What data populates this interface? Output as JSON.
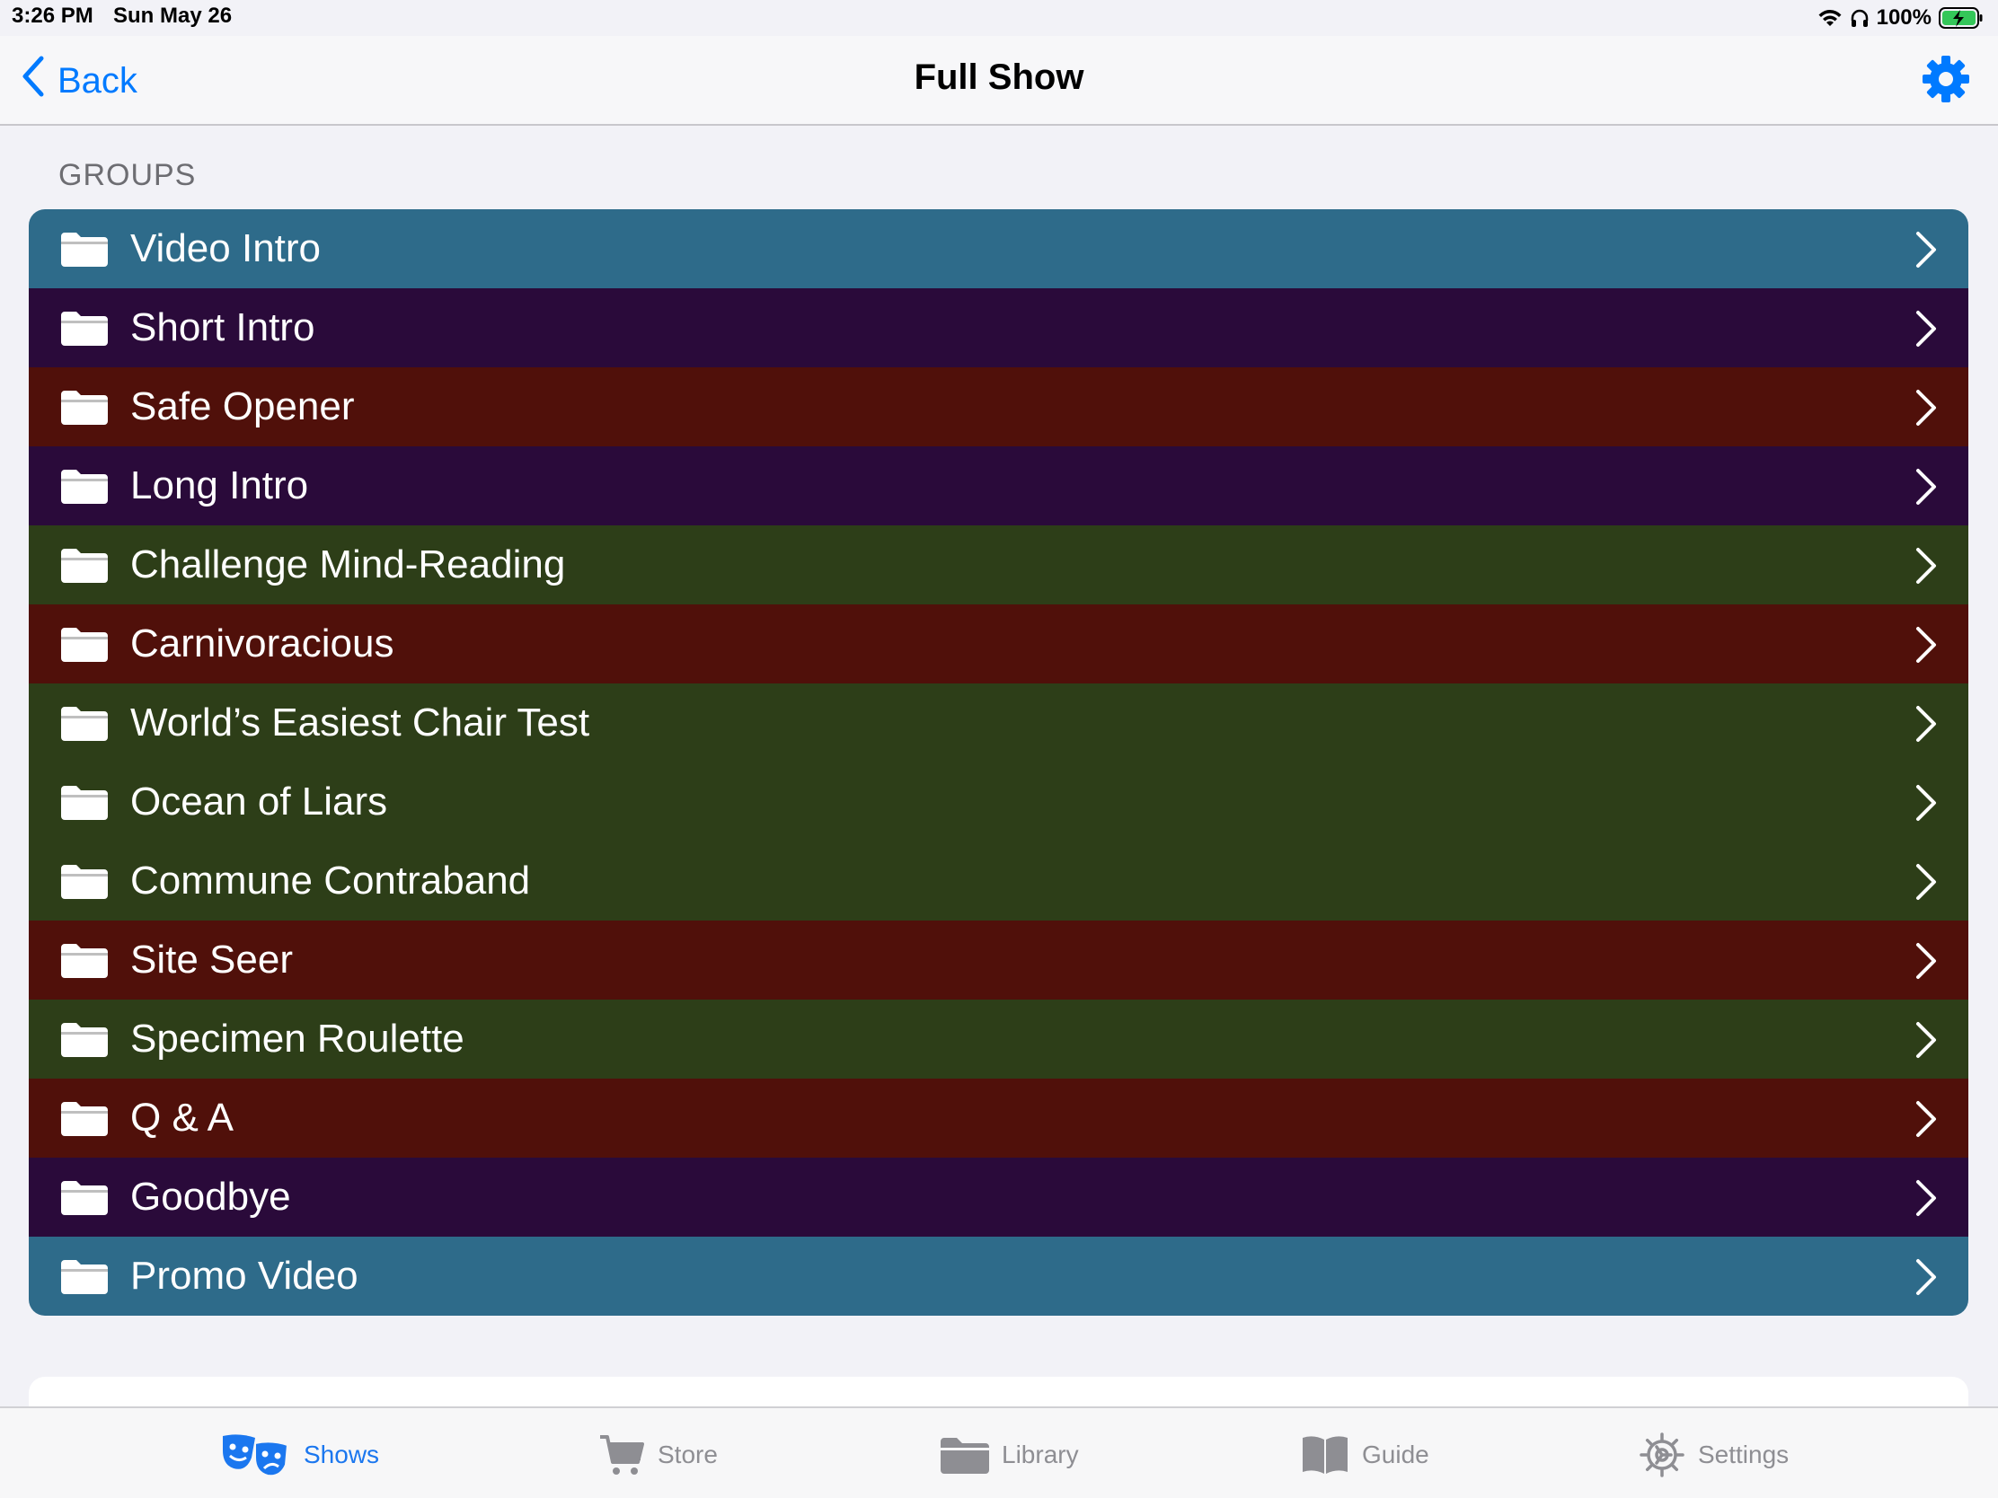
{
  "status_bar": {
    "time": "3:26 PM",
    "date": "Sun May 26",
    "battery_percent": "100%",
    "icons": [
      "wifi-icon",
      "headphones-icon",
      "battery-charging-icon"
    ]
  },
  "nav": {
    "back_label": "Back",
    "title": "Full Show",
    "right_icon": "gear-icon",
    "accent_color": "#007aff"
  },
  "groups": {
    "header": "GROUPS",
    "items": [
      {
        "label": "Video Intro",
        "color": "#2e6b8a"
      },
      {
        "label": "Short Intro",
        "color": "#2a0a3a"
      },
      {
        "label": "Safe Opener",
        "color": "#50100a"
      },
      {
        "label": "Long Intro",
        "color": "#2a0a3a"
      },
      {
        "label": "Challenge Mind-Reading",
        "color": "#2d3e18"
      },
      {
        "label": "Carnivoracious",
        "color": "#50100a"
      },
      {
        "label": "World’s Easiest Chair Test",
        "color": "#2d3e18"
      },
      {
        "label": "Ocean of Liars",
        "color": "#2d3e18"
      },
      {
        "label": "Commune Contraband",
        "color": "#2d3e18"
      },
      {
        "label": "Site Seer",
        "color": "#50100a"
      },
      {
        "label": "Specimen Roulette",
        "color": "#2d3e18"
      },
      {
        "label": "Q & A",
        "color": "#50100a"
      },
      {
        "label": "Goodbye",
        "color": "#2a0a3a"
      },
      {
        "label": "Promo Video",
        "color": "#2e6b8a"
      }
    ]
  },
  "tab_bar": {
    "tabs": [
      {
        "label": "Shows",
        "icon": "theater-masks-icon",
        "active": true
      },
      {
        "label": "Store",
        "icon": "cart-icon",
        "active": false
      },
      {
        "label": "Library",
        "icon": "folder-icon",
        "active": false
      },
      {
        "label": "Guide",
        "icon": "book-icon",
        "active": false
      },
      {
        "label": "Settings",
        "icon": "gear-icon",
        "active": false
      }
    ],
    "active_color": "#1b77ef",
    "inactive_color": "#8e8e93"
  }
}
